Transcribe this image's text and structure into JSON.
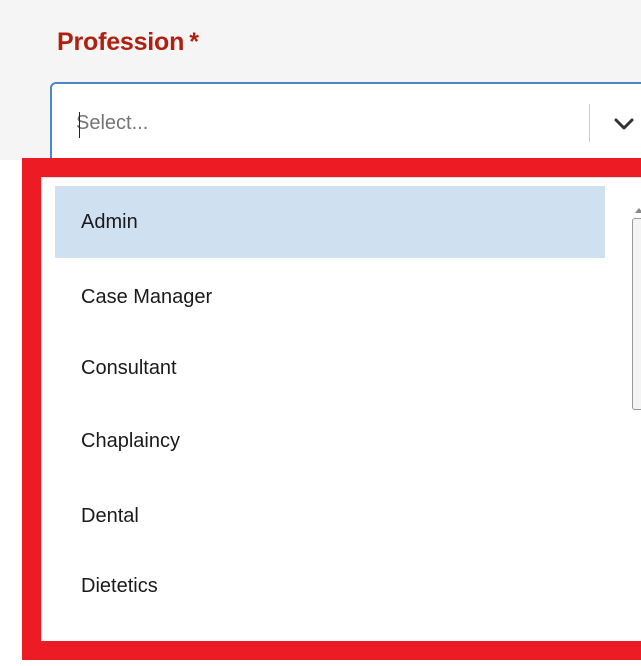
{
  "field": {
    "label": "Profession",
    "required_marker": "*",
    "placeholder": "Select...",
    "chevron_icon": "chevron-down-icon"
  },
  "dropdown": {
    "options": [
      {
        "label": "Admin",
        "highlighted": true
      },
      {
        "label": "Case Manager",
        "highlighted": false
      },
      {
        "label": "Consultant",
        "highlighted": false
      },
      {
        "label": "Chaplaincy",
        "highlighted": false
      },
      {
        "label": "Dental",
        "highlighted": false
      },
      {
        "label": "Dietetics",
        "highlighted": false
      }
    ]
  },
  "colors": {
    "label_text": "#b02010",
    "input_border": "#4a86c8",
    "highlight": "#cfe0f0",
    "annotation_box": "#ed1c24"
  }
}
